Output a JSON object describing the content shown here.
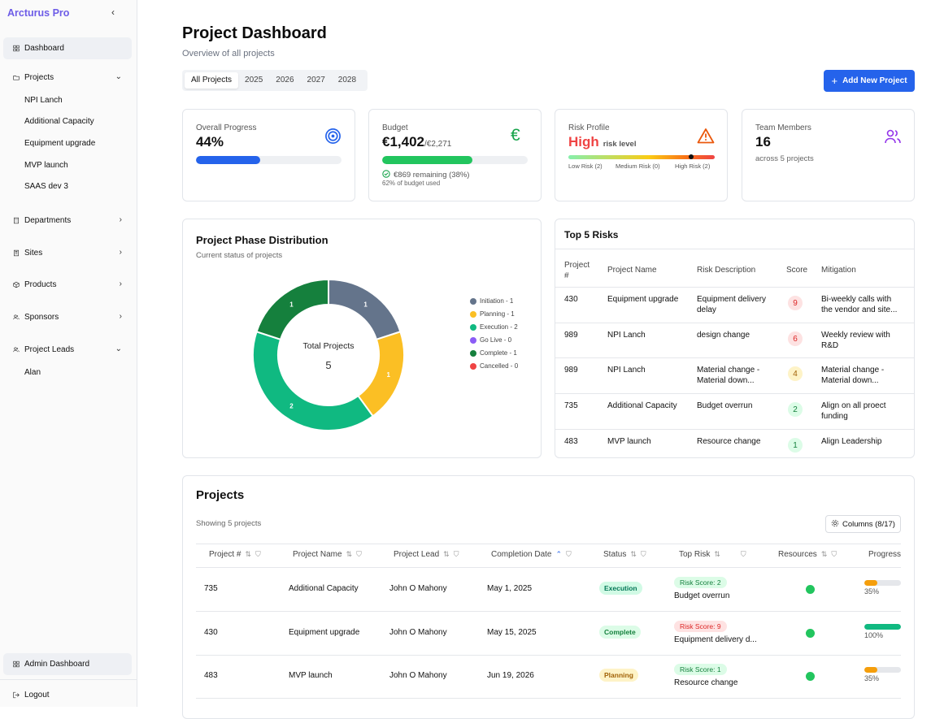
{
  "app": {
    "name": "Arcturus Pro"
  },
  "sidebar": {
    "collapse_icon": "chevron-left-icon",
    "dashboard": "Dashboard",
    "projects": "Projects",
    "project_children": [
      "NPI Lanch",
      "Additional Capacity",
      "Equipment upgrade",
      "MVP launch",
      "SAAS dev 3"
    ],
    "departments": "Departments",
    "sites": "Sites",
    "products": "Products",
    "sponsors": "Sponsors",
    "project_leads": "Project Leads",
    "lead_children": [
      "Alan"
    ],
    "admin_dashboard": "Admin Dashboard",
    "logout": "Logout"
  },
  "header": {
    "title": "Project Dashboard",
    "subtitle": "Overview of all projects",
    "tabs": [
      "All Projects",
      "2025",
      "2026",
      "2027",
      "2028"
    ],
    "active_tab": "All Projects",
    "add_button": "Add New Project"
  },
  "kpis": {
    "progress": {
      "label": "Overall Progress",
      "value": "44%",
      "fraction": 0.44,
      "color": "#2563eb"
    },
    "budget": {
      "label": "Budget",
      "value": "€1,402",
      "total": "/€2,271",
      "used_fraction": 0.62,
      "remaining": "€869 remaining (38%)",
      "used_text": "62% of budget used",
      "color": "#22c55e"
    },
    "risk": {
      "label": "Risk Profile",
      "level": "High",
      "level_suffix": "risk level",
      "low": "Low Risk (2)",
      "medium": "Medium Risk (0)",
      "high": "High Risk (2)"
    },
    "team": {
      "label": "Team Members",
      "value": "16",
      "sub": "across 5 projects"
    }
  },
  "phase": {
    "title": "Project Phase Distribution",
    "subtitle": "Current status of projects",
    "center_label": "Total Projects",
    "center_value": "5",
    "legend": [
      "Initiation - 1",
      "Planning - 1",
      "Execution - 2",
      "Go Live - 0",
      "Complete - 1",
      "Cancelled - 0"
    ],
    "colors": [
      "#64748b",
      "#fbbf24",
      "#10b981",
      "#8b5cf6",
      "#15803d",
      "#ef4444"
    ]
  },
  "chart_data": {
    "type": "pie",
    "categories": [
      "Initiation",
      "Planning",
      "Execution",
      "Go Live",
      "Complete",
      "Cancelled"
    ],
    "values": [
      1,
      1,
      2,
      0,
      1,
      0
    ],
    "title": "Project Phase Distribution"
  },
  "risks": {
    "title": "Top 5 Risks",
    "headers": [
      "Project\n#",
      "Project Name",
      "Risk Description",
      "Score",
      "Mitigation"
    ],
    "rows": [
      {
        "num": "430",
        "name": "Equipment upgrade",
        "desc": [
          "Equipment delivery",
          "delay"
        ],
        "score": "9",
        "mitig": [
          "Bi-weekly calls with",
          "the vendor and site..."
        ],
        "bg": "#fde2e2",
        "fg": "#dc2626"
      },
      {
        "num": "989",
        "name": "NPI Lanch",
        "desc": [
          "design change"
        ],
        "score": "6",
        "mitig": [
          "Weekly review with",
          "R&D"
        ],
        "bg": "#fde2e2",
        "fg": "#dc2626"
      },
      {
        "num": "989",
        "name": "NPI Lanch",
        "desc": [
          "Material change -",
          "Material down..."
        ],
        "score": "4",
        "mitig": [
          "Material change -",
          "Material down..."
        ],
        "bg": "#fef3c7",
        "fg": "#a16207"
      },
      {
        "num": "735",
        "name": "Additional Capacity",
        "desc": [
          "Budget overrun"
        ],
        "score": "2",
        "mitig": [
          "Align on all proect",
          "funding"
        ],
        "bg": "#dcfce7",
        "fg": "#15803d"
      },
      {
        "num": "483",
        "name": "MVP launch",
        "desc": [
          "Resource change"
        ],
        "score": "1",
        "mitig": [
          "Align Leadership"
        ],
        "bg": "#dcfce7",
        "fg": "#15803d"
      }
    ]
  },
  "projects": {
    "title": "Projects",
    "showing": "Showing 5 projects",
    "columns_button": "Columns (8/17)",
    "headers": [
      "Project #",
      "Project Name",
      "Project Lead",
      "Completion Date",
      "Status",
      "Top Risk",
      "Resources",
      "Progress"
    ],
    "rows": [
      {
        "num": "735",
        "name": "Additional Capacity",
        "lead": "John O Mahony",
        "date": "May 1, 2025",
        "status": "Execution",
        "status_bg": "#d1fae5",
        "status_fg": "#047857",
        "risk": "Risk Score: 2",
        "risk_bg": "#dcfce7",
        "risk_fg": "#15803d",
        "risk_desc": "Budget overrun",
        "progress": "35%",
        "progress_fraction": 0.35,
        "progress_color": "#f59e0b"
      },
      {
        "num": "430",
        "name": "Equipment upgrade",
        "lead": "John O Mahony",
        "date": "May 15, 2025",
        "status": "Complete",
        "status_bg": "#dcfce7",
        "status_fg": "#15803d",
        "risk": "Risk Score: 9",
        "risk_bg": "#fee2e2",
        "risk_fg": "#dc2626",
        "risk_desc": "Equipment delivery d...",
        "progress": "100%",
        "progress_fraction": 1.0,
        "progress_color": "#10b981"
      },
      {
        "num": "483",
        "name": "MVP launch",
        "lead": "John O Mahony",
        "date": "Jun 19, 2026",
        "status": "Planning",
        "status_bg": "#fef3c7",
        "status_fg": "#a16207",
        "risk": "Risk Score: 1",
        "risk_bg": "#dcfce7",
        "risk_fg": "#15803d",
        "risk_desc": "Resource change",
        "progress": "35%",
        "progress_fraction": 0.35,
        "progress_color": "#f59e0b"
      }
    ]
  }
}
